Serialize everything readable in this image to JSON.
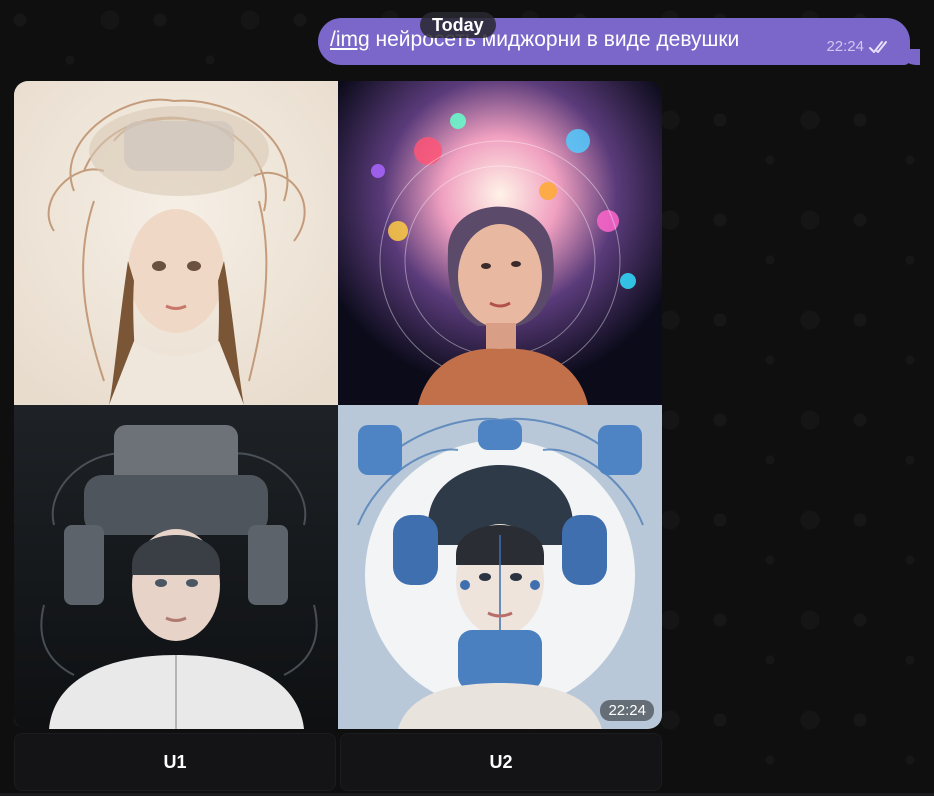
{
  "chat": {
    "date_separator": "Today"
  },
  "outgoing_message": {
    "command": "/img",
    "text": " нейросеть миджорни в виде девушки",
    "time": "22:24",
    "status_icon": "double-check-icon"
  },
  "image_message": {
    "time": "22:24",
    "images": [
      {
        "name": "girl-wire-hair-portrait"
      },
      {
        "name": "girl-colorful-burst-portrait"
      },
      {
        "name": "girl-mechanical-helmet-portrait"
      },
      {
        "name": "girl-blue-robot-headphones-portrait"
      }
    ]
  },
  "keyboard": {
    "buttons": [
      "U1",
      "U2"
    ]
  },
  "colors": {
    "outgoing_bubble": "#7b67c9",
    "background": "#0f0f10"
  }
}
